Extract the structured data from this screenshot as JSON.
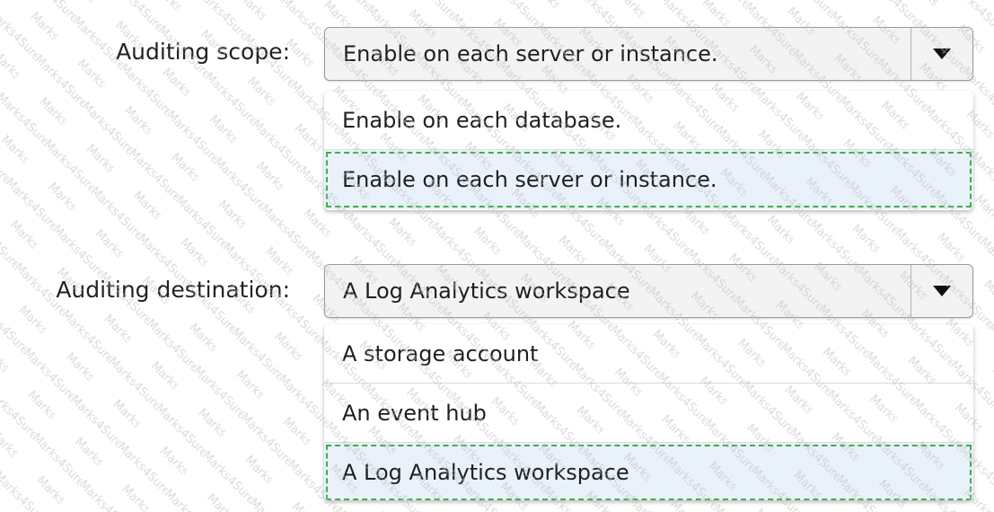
{
  "auditing_scope": {
    "label": "Auditing scope:",
    "selected_value": "Enable on each server or instance.",
    "options": [
      {
        "label": "Enable on each database.",
        "selected": false
      },
      {
        "label": "Enable on each server or instance.",
        "selected": true
      }
    ]
  },
  "auditing_destination": {
    "label": "Auditing destination:",
    "selected_value": "A Log Analytics workspace",
    "options": [
      {
        "label": "A storage account",
        "selected": false
      },
      {
        "label": "An event hub",
        "selected": false
      },
      {
        "label": "A Log Analytics workspace",
        "selected": true
      }
    ]
  },
  "watermark": {
    "text": "Marks4Sure"
  },
  "icons": {
    "dropdown_arrow": "triangle-down-icon"
  },
  "colors": {
    "selected_option_background": "#e9f1fb",
    "selected_option_outline": "#3fae49",
    "select_background": "#f3f3f3"
  }
}
